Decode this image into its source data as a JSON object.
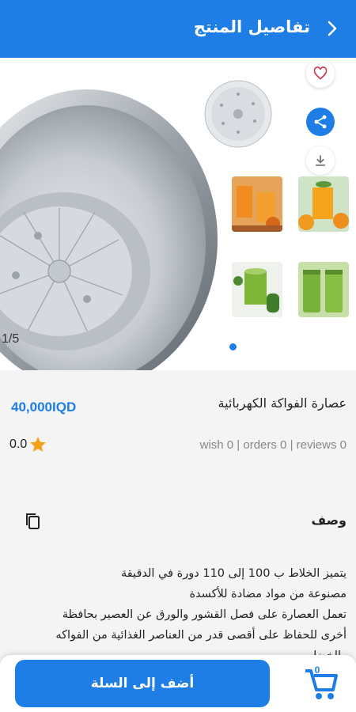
{
  "header": {
    "title": "تفاصيل المنتج",
    "back_icon": "chevron-right-icon",
    "color": "#1e7ee6"
  },
  "gallery": {
    "counter": "1/5",
    "actions": {
      "favorite_icon": "heart-icon",
      "share_icon": "share-icon",
      "download_icon": "download-icon"
    },
    "thumbnails": [
      "orange-juice-glasses",
      "orange-juice-fruit",
      "green-juice-cucumber",
      "green-juice-bottles"
    ]
  },
  "product": {
    "name": "عصارة الفواكة الكهربائية",
    "price": "40,000IQD",
    "stats": "wish 0 | orders 0 | reviews 0",
    "rating": "0.0"
  },
  "description": {
    "title": "وصف",
    "lines": [
      "يتميز الخلاط ب 100 إلى 110 دورة في الدقيقة",
      "مصنوعة من مواد مضادة للأكسدة",
      "تعمل العصارة على فصل القشور والورق عن العصير بحافظة",
      "أخرى للحفاظ على أقصى قدر من العناصر الغذائية من الفواكه",
      "والخضار"
    ],
    "copy_icon": "copy-icon"
  },
  "bottom_bar": {
    "add_to_cart_label": "أضف إلى السلة",
    "cart_count": "0",
    "cart_icon": "cart-icon"
  }
}
